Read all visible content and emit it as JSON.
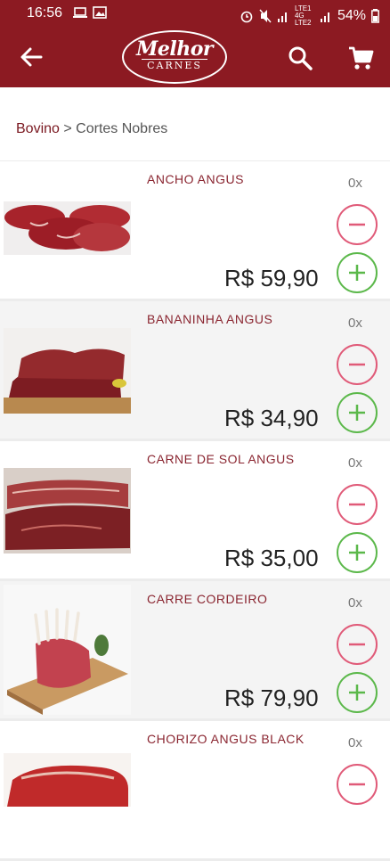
{
  "status": {
    "time": "16:56",
    "network": "LTE1 4G LTE2",
    "battery": "54%"
  },
  "header": {
    "logo_top": "Melhor",
    "logo_bottom": "CARNES"
  },
  "breadcrumb": {
    "category": "Bovino",
    "separator": " > ",
    "subcategory": "Cortes Nobres"
  },
  "products": [
    {
      "name": "ANCHO ANGUS",
      "qty": "0x",
      "price": "R$ 59,90"
    },
    {
      "name": "BANANINHA ANGUS",
      "qty": "0x",
      "price": "R$ 34,90"
    },
    {
      "name": "CARNE DE SOL ANGUS",
      "qty": "0x",
      "price": "R$ 35,00"
    },
    {
      "name": "CARRE CORDEIRO",
      "qty": "0x",
      "price": "R$ 79,90"
    },
    {
      "name": "CHORIZO ANGUS BLACK",
      "qty": "0x",
      "price": ""
    }
  ],
  "colors": {
    "brand": "#8c1a22",
    "minus": "#e05a78",
    "plus": "#5bb84a"
  }
}
